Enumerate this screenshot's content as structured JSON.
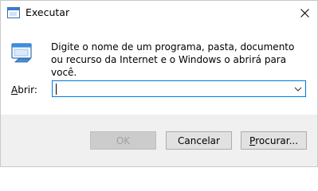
{
  "window": {
    "title": "Executar"
  },
  "main": {
    "description": "Digite o nome de um programa, pasta, documento ou recurso da Internet e o Windows o abrirá para você.",
    "open_label_mnemonic": "A",
    "open_label_rest": "brir:",
    "input_value": ""
  },
  "buttons": {
    "ok": "OK",
    "cancel": "Cancelar",
    "browse_mnemonic": "P",
    "browse_rest": "rocurar..."
  },
  "colors": {
    "focus_border": "#0078d7",
    "footer_bg": "#f0f0f0",
    "disabled_text": "#a0a0a0"
  }
}
